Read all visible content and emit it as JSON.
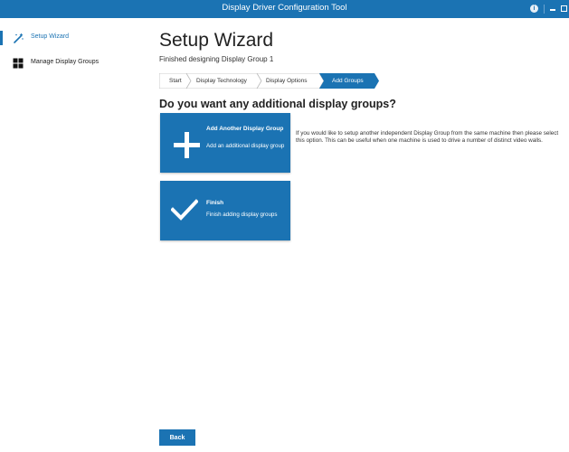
{
  "window": {
    "title": "Display Driver Configuration Tool",
    "info_glyph": "i",
    "controls": [
      "info-icon",
      "minimize-icon",
      "maximize-icon"
    ]
  },
  "sidebar": {
    "items": [
      {
        "label": "Setup Wizard",
        "icon": "wand-icon",
        "active": true
      },
      {
        "label": "Manage Display Groups",
        "icon": "grid-icon",
        "active": false
      }
    ]
  },
  "main": {
    "title": "Setup Wizard",
    "subtitle": "Finished designing Display Group 1",
    "steps": [
      {
        "label": "Start",
        "active": false
      },
      {
        "label": "Display Technology",
        "active": false
      },
      {
        "label": "Display Options",
        "active": false
      },
      {
        "label": "Add Groups",
        "active": true
      }
    ],
    "question": "Do you want any additional display groups?",
    "tiles": {
      "add": {
        "icon": "plus-icon",
        "title": "Add Another Display Group",
        "description": "Add an additional display group"
      },
      "finish": {
        "icon": "checkmark-icon",
        "title": "Finish",
        "description": "Finish adding display groups"
      }
    },
    "explanation": "If you would like to setup another independent Display Group from the same machine then please select this option. This can be useful when one machine is used to drive a number of distinct video walls.",
    "back_label": "Back"
  },
  "colors": {
    "accent": "#1b73b3",
    "background": "#ffffff",
    "text": "#222222"
  }
}
